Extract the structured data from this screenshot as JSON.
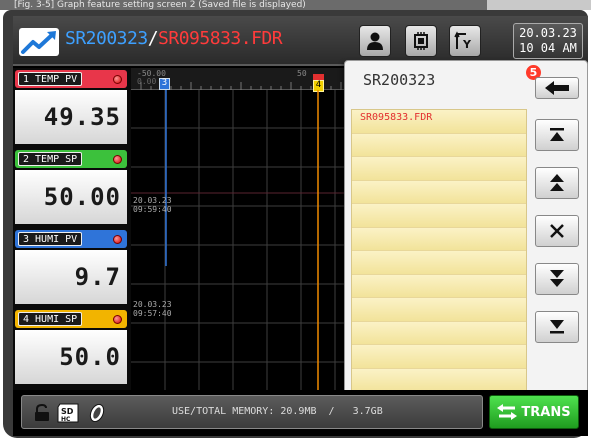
{
  "caption": {
    "text": "[Fig. 3-5] Graph feature setting screen 2 (Saved file is displayed)"
  },
  "header": {
    "title_main": "SR200323",
    "title_sep": "/",
    "title_file": "SR095833.FDR",
    "date": "20.03.23",
    "time": "10 04 AM"
  },
  "channels": [
    {
      "label": "1 TEMP PV",
      "value": "49.35",
      "color": "#e8364a"
    },
    {
      "label": "2 TEMP SP",
      "value": "50.00",
      "color": "#3cc13c"
    },
    {
      "label": "3 HUMI PV",
      "value": "9.7",
      "color": "#2f74d9"
    },
    {
      "label": "4 HUMI SP",
      "value": "50.0",
      "color": "#f2b400"
    }
  ],
  "graph": {
    "scale_left": "-50.00",
    "scale_left_sub": "0.00",
    "scale_mid": "50",
    "cursor_left": "3",
    "cursor_right": "4",
    "stamp1_date": "20.03.23",
    "stamp1_time": "09:59:40",
    "stamp2_date": "20.03.23",
    "stamp2_time": "09:57:40"
  },
  "filelist": {
    "title": "SR200323",
    "badge": "5",
    "rows": [
      "SR095833.FDR",
      "",
      "",
      "",
      "",
      "",
      "",
      "",
      "",
      "",
      "",
      ""
    ],
    "icons": {
      "back": "arrow-left-icon",
      "top": "jump-top-icon",
      "page_up": "page-up-icon",
      "close": "close-icon",
      "page_down": "page-down-icon",
      "bottom": "jump-bottom-icon"
    }
  },
  "status": {
    "memory_text": "USE/TOTAL MEMORY: 20.9MB  /   3.7GB",
    "trans_label": "TRANS"
  }
}
